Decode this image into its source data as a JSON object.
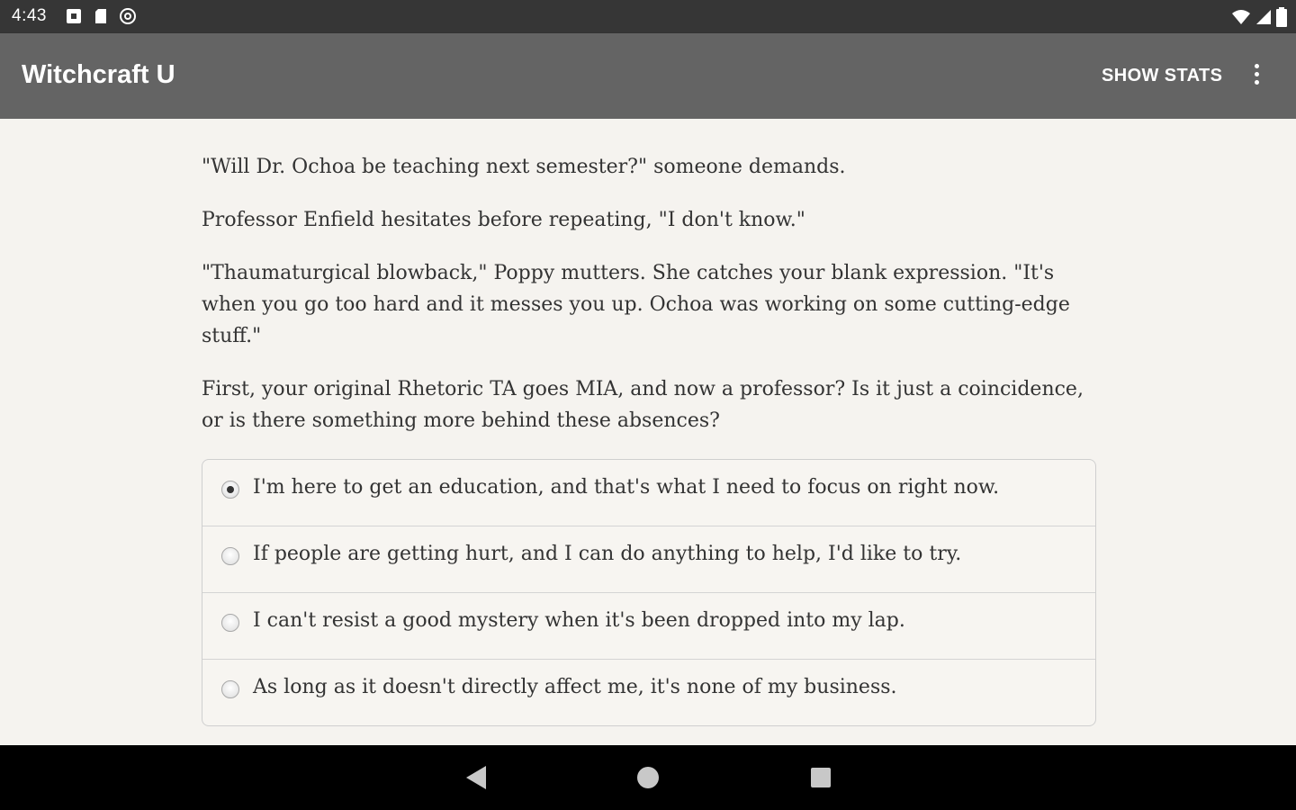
{
  "status_bar": {
    "time": "4:43",
    "left_icons": [
      "notification-icon",
      "sd-card-icon",
      "at-sign-icon"
    ],
    "right_icons": [
      "wifi-icon",
      "cell-signal-icon",
      "battery-icon"
    ]
  },
  "app_bar": {
    "title": "Witchcraft U",
    "show_stats_label": "SHOW STATS",
    "overflow_icon": "more-vert-icon",
    "background_color": "#646464"
  },
  "story": {
    "paragraphs": [
      "\"Will Dr. Ochoa be teaching next semester?\" someone demands.",
      "Professor Enfield hesitates before repeating, \"I don't know.\"",
      "\"Thaumaturgical blowback,\" Poppy mutters. She catches your blank expression. \"It's when you go too hard and it messes you up. Ochoa was working on some cutting-edge stuff.\"",
      "First, your original Rhetoric TA goes MIA, and now a professor? Is it just a coincidence, or is there something more behind these absences?"
    ]
  },
  "choices": [
    {
      "label": "I'm here to get an education, and that's what I need to focus on right now.",
      "selected": true
    },
    {
      "label": "If people are getting hurt, and I can do anything to help, I'd like to try.",
      "selected": false
    },
    {
      "label": "I can't resist a good mystery when it's been dropped into my lap.",
      "selected": false
    },
    {
      "label": "As long as it doesn't directly affect me, it's none of my business.",
      "selected": false
    }
  ],
  "nav_bar": {
    "icons": [
      "back-icon",
      "home-icon",
      "recents-icon"
    ]
  }
}
